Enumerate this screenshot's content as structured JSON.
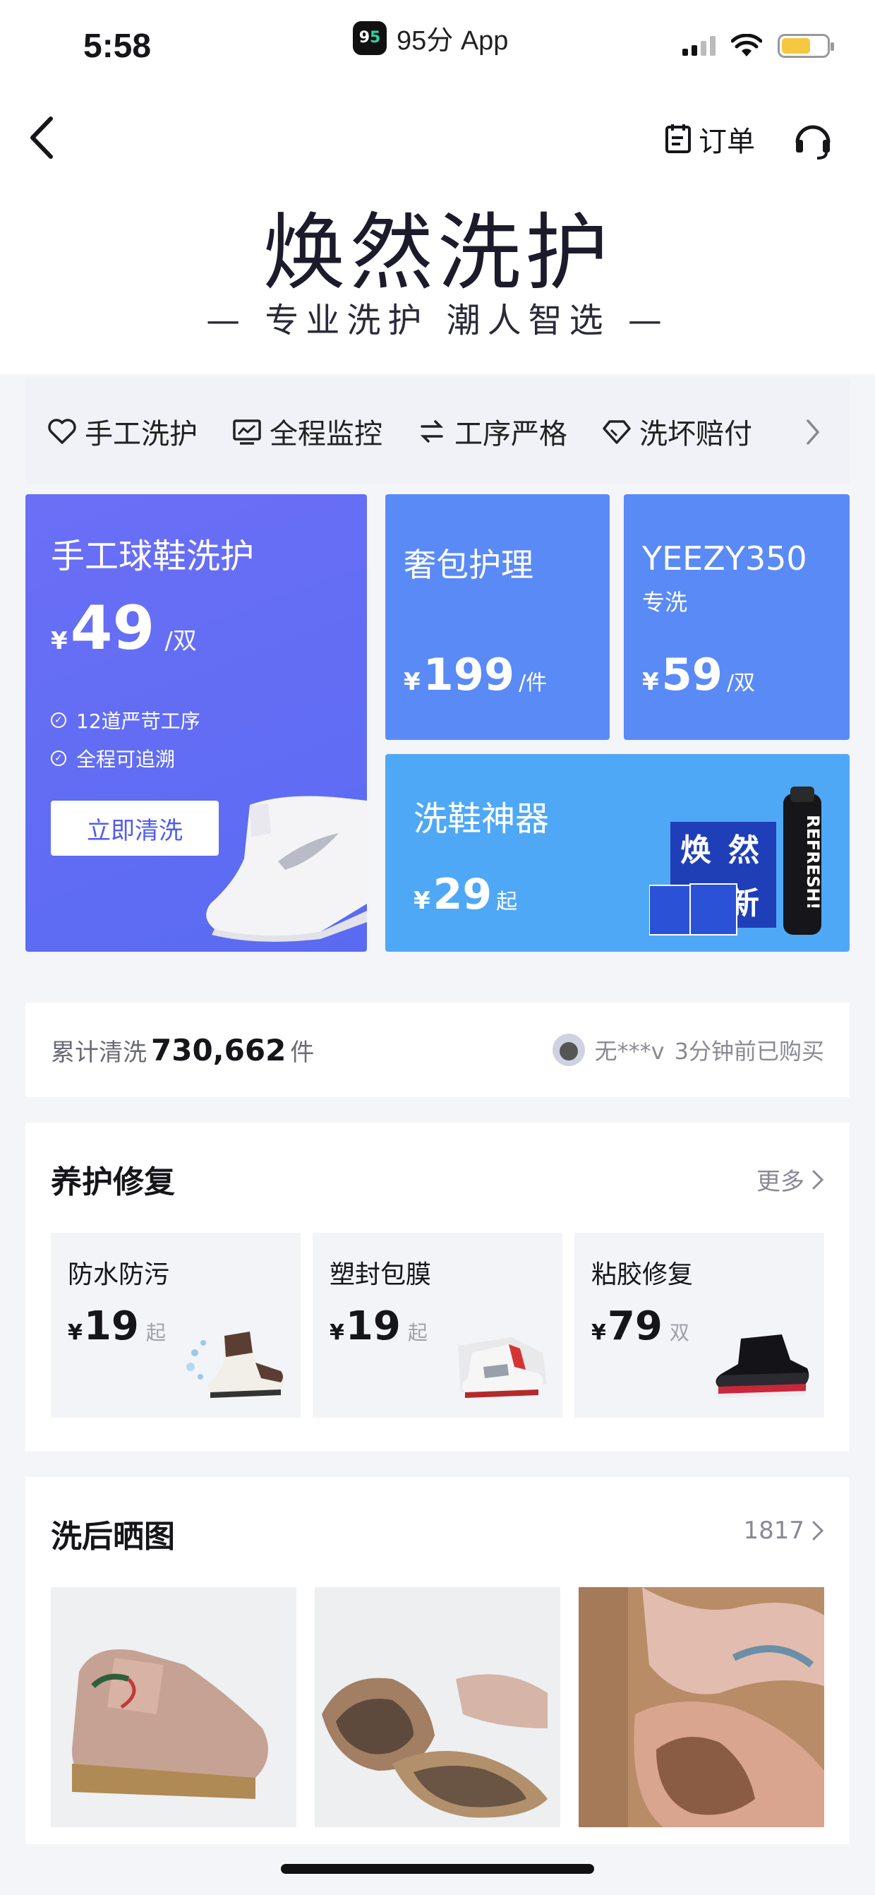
{
  "status_bar": {
    "time": "5:58",
    "app_label": "95分 App",
    "logo_text_a": "9",
    "logo_text_b": "5",
    "battery_level": 0.65
  },
  "header": {
    "back_icon": "chevron-left-icon",
    "orders_label": "订单",
    "orders_icon": "order-list-icon",
    "service_icon": "headset-icon"
  },
  "brand": {
    "title": "焕然洗护",
    "slogan": "— 专业洗护 潮人智选 —"
  },
  "features": [
    {
      "label": "手工洗护",
      "icon": "heart-hand-icon"
    },
    {
      "label": "全程监控",
      "icon": "monitor-chart-icon"
    },
    {
      "label": "工序严格",
      "icon": "swap-arrows-icon"
    },
    {
      "label": "洗坏赔付",
      "icon": "diamond-icon"
    }
  ],
  "services": {
    "sneaker": {
      "title": "手工球鞋洗护",
      "currency": "¥",
      "price": "49",
      "unit": "/双",
      "perks": [
        "12道严苛工序",
        "全程可追溯"
      ],
      "button": "立即清洗"
    },
    "bag": {
      "title": "奢包护理",
      "currency": "¥",
      "price": "199",
      "unit": "/件"
    },
    "yeezy": {
      "title": "YEEZY350",
      "subtitle": "专洗",
      "currency": "¥",
      "price": "59",
      "unit": "/双"
    },
    "tool": {
      "title": "洗鞋神器",
      "currency": "¥",
      "price": "29",
      "unit": "起",
      "product_text_1": "焕",
      "product_text_2": "然",
      "product_text_3": "新",
      "product_brand": "REFRESH!"
    }
  },
  "stats": {
    "label": "累计清洗",
    "count": "730,662",
    "unit": "件",
    "recent_user": "无***v",
    "recent_text": "3分钟前已购买"
  },
  "care": {
    "title": "养护修复",
    "more": "更多",
    "items": [
      {
        "title": "防水防污",
        "currency": "¥",
        "price": "19",
        "unit": "起"
      },
      {
        "title": "塑封包膜",
        "currency": "¥",
        "price": "19",
        "unit": "起"
      },
      {
        "title": "粘胶修复",
        "currency": "¥",
        "price": "79",
        "unit": "双"
      }
    ]
  },
  "photos": {
    "title": "洗后晒图",
    "count": "1817"
  },
  "colors": {
    "main_card": "#5f6cf3",
    "secondary_card": "#5a8af5",
    "tool_card": "#4fa8f6",
    "accent_button_text": "#4f5cf0"
  }
}
